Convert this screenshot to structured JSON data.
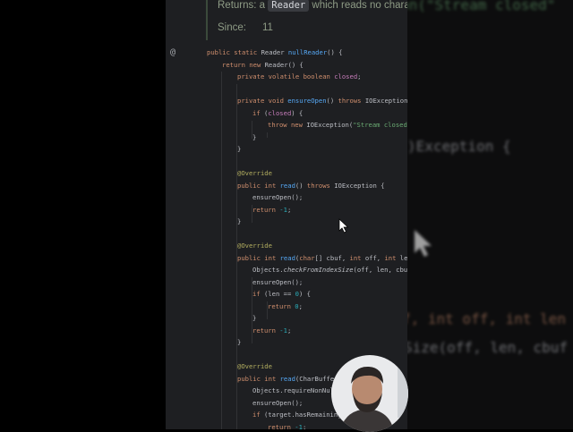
{
  "doc": {
    "returns_label": "Returns:",
    "returns_prefix": "a",
    "returns_code": "Reader",
    "returns_text": "which reads no characters.",
    "since_label": "Since:",
    "since_value": "11"
  },
  "gutter": {
    "override_marker": "@"
  },
  "code_lines": [
    {
      "indent": 0,
      "tokens": [
        [
          "public static ",
          "k"
        ],
        [
          "Reader ",
          "p"
        ],
        [
          "nullReader",
          "f"
        ],
        [
          "() {",
          "p"
        ]
      ]
    },
    {
      "indent": 1,
      "tokens": [
        [
          "return new ",
          "k"
        ],
        [
          "Reader() {",
          "p"
        ]
      ]
    },
    {
      "indent": 2,
      "tokens": [
        [
          "private volatile boolean ",
          "k"
        ],
        [
          "closed",
          "v"
        ],
        [
          ";",
          "p"
        ]
      ]
    },
    {
      "indent": 2,
      "tokens": []
    },
    {
      "indent": 2,
      "tokens": [
        [
          "private void ",
          "k"
        ],
        [
          "ensureOpen",
          "f"
        ],
        [
          "() ",
          "p"
        ],
        [
          "throws ",
          "k"
        ],
        [
          "IOException {",
          "p"
        ]
      ]
    },
    {
      "indent": 3,
      "tokens": [
        [
          "if ",
          "k"
        ],
        [
          "(",
          "p"
        ],
        [
          "closed",
          "v"
        ],
        [
          ") {",
          "p"
        ]
      ]
    },
    {
      "indent": 4,
      "tokens": [
        [
          "throw new ",
          "k"
        ],
        [
          "IOException(",
          "p"
        ],
        [
          "\"Stream closed\"",
          "s"
        ],
        [
          ");",
          "p"
        ]
      ]
    },
    {
      "indent": 3,
      "tokens": [
        [
          "}",
          "p"
        ]
      ]
    },
    {
      "indent": 2,
      "tokens": [
        [
          "}",
          "p"
        ]
      ]
    },
    {
      "indent": 2,
      "tokens": []
    },
    {
      "indent": 2,
      "tokens": [
        [
          "@Override",
          "a"
        ]
      ]
    },
    {
      "indent": 2,
      "tokens": [
        [
          "public int ",
          "k"
        ],
        [
          "read",
          "f"
        ],
        [
          "() ",
          "p"
        ],
        [
          "throws ",
          "k"
        ],
        [
          "IOException {",
          "p"
        ]
      ]
    },
    {
      "indent": 3,
      "tokens": [
        [
          "ensureOpen();",
          "p"
        ]
      ]
    },
    {
      "indent": 3,
      "tokens": [
        [
          "return ",
          "k"
        ],
        [
          "-1",
          "n"
        ],
        [
          ";",
          "p"
        ]
      ]
    },
    {
      "indent": 2,
      "tokens": [
        [
          "}",
          "p"
        ]
      ]
    },
    {
      "indent": 2,
      "tokens": []
    },
    {
      "indent": 2,
      "tokens": [
        [
          "@Override",
          "a"
        ]
      ]
    },
    {
      "indent": 2,
      "tokens": [
        [
          "public int ",
          "k"
        ],
        [
          "read",
          "f"
        ],
        [
          "(",
          "p"
        ],
        [
          "char",
          "k"
        ],
        [
          "[] cbuf, ",
          "p"
        ],
        [
          "int ",
          "k"
        ],
        [
          "off, ",
          "p"
        ],
        [
          "int ",
          "k"
        ],
        [
          "len) {",
          "p"
        ]
      ]
    },
    {
      "indent": 3,
      "tokens": [
        [
          "Objects.",
          "p"
        ],
        [
          "checkFromIndexSize",
          "i"
        ],
        [
          "(off, len, cbuf.length);",
          "p"
        ]
      ]
    },
    {
      "indent": 3,
      "tokens": [
        [
          "ensureOpen();",
          "p"
        ]
      ]
    },
    {
      "indent": 3,
      "tokens": [
        [
          "if ",
          "k"
        ],
        [
          "(len == ",
          "p"
        ],
        [
          "0",
          "n"
        ],
        [
          ") {",
          "p"
        ]
      ]
    },
    {
      "indent": 4,
      "tokens": [
        [
          "return ",
          "k"
        ],
        [
          "0",
          "n"
        ],
        [
          ";",
          "p"
        ]
      ]
    },
    {
      "indent": 3,
      "tokens": [
        [
          "}",
          "p"
        ]
      ]
    },
    {
      "indent": 3,
      "tokens": [
        [
          "return ",
          "k"
        ],
        [
          "-1",
          "n"
        ],
        [
          ";",
          "p"
        ]
      ]
    },
    {
      "indent": 2,
      "tokens": [
        [
          "}",
          "p"
        ]
      ]
    },
    {
      "indent": 2,
      "tokens": []
    },
    {
      "indent": 2,
      "tokens": [
        [
          "@Override",
          "a"
        ]
      ]
    },
    {
      "indent": 2,
      "tokens": [
        [
          "public int ",
          "k"
        ],
        [
          "read",
          "f"
        ],
        [
          "(CharBuffer target) {",
          "p"
        ]
      ]
    },
    {
      "indent": 3,
      "tokens": [
        [
          "Objects.requireNonNull(target);",
          "p"
        ]
      ]
    },
    {
      "indent": 3,
      "tokens": [
        [
          "ensureOpen();",
          "p"
        ]
      ]
    },
    {
      "indent": 3,
      "tokens": [
        [
          "if ",
          "k"
        ],
        [
          "(target.hasRemaining()) {",
          "p"
        ]
      ]
    },
    {
      "indent": 4,
      "tokens": [
        [
          "return ",
          "k"
        ],
        [
          "-1",
          "n"
        ],
        [
          ";",
          "p"
        ]
      ]
    }
  ],
  "blurred_background": [
    {
      "text": "on(\"Stream closed\"",
      "color": "#6aab73"
    },
    {
      "text": ")Exception {",
      "color": "#bcbec4"
    },
    {
      "text": "f, int off, int len",
      "color": "#cf8e6d"
    },
    {
      "text": "Size(off, len, cbuf",
      "color": "#bcbec4"
    }
  ]
}
